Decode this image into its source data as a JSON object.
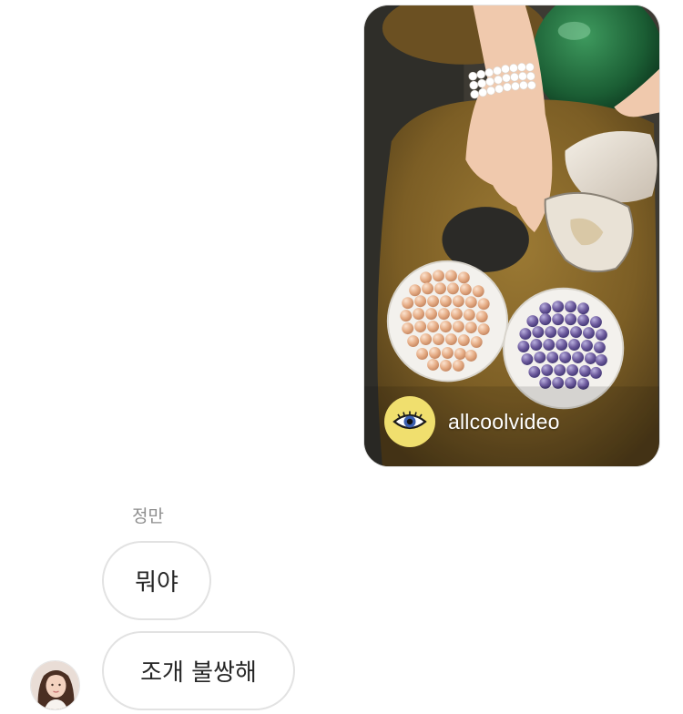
{
  "shared_post": {
    "author": "allcoolvideo",
    "author_avatar_icon": "eye-icon",
    "scene_description_colors": {
      "rock": "#8a6a2c",
      "water": "#3f3b33",
      "bowl": "#f2f0ec",
      "pearl_peach": "#e9b28e",
      "pearl_purple": "#6f5c9e",
      "glass_ball": "#1f6a3c"
    }
  },
  "conversation": {
    "sender_name": "정만",
    "messages": [
      {
        "text": "뭐야"
      },
      {
        "text": "조개 불쌍해"
      }
    ]
  }
}
